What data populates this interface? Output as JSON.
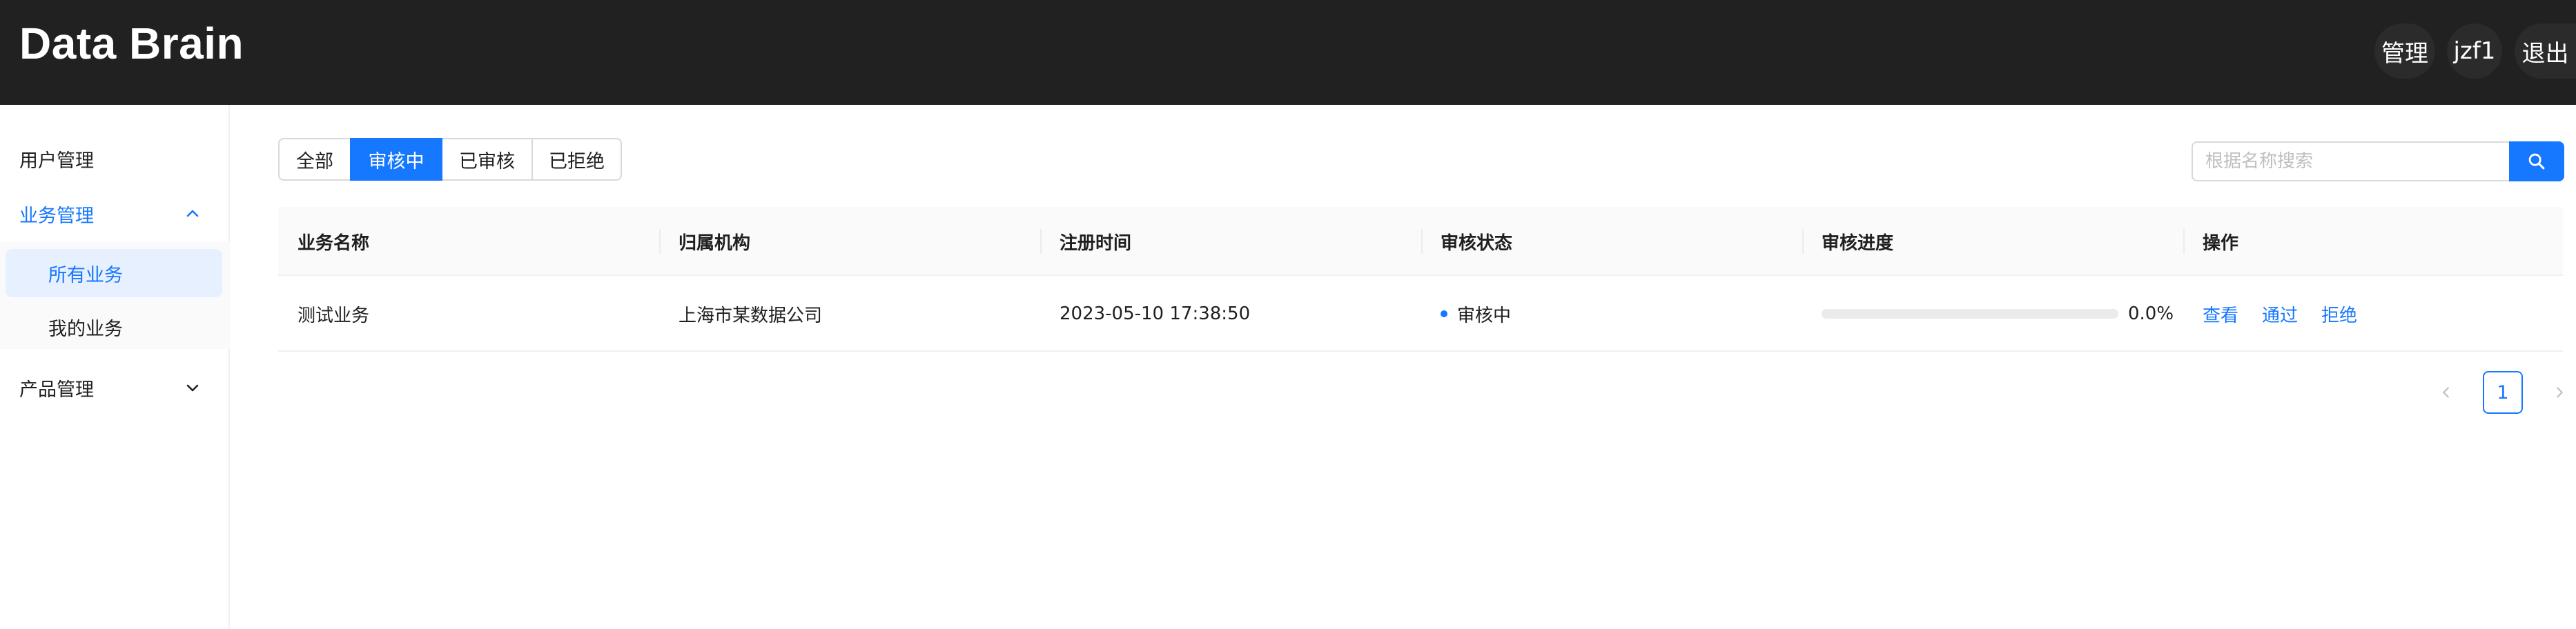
{
  "header": {
    "brand": "Data Brain",
    "nav": [
      "管理",
      "jzf1",
      "退出"
    ]
  },
  "sidebar": {
    "items": [
      {
        "label": "用户管理"
      },
      {
        "label": "业务管理",
        "children": [
          "所有业务",
          "我的业务"
        ]
      },
      {
        "label": "产品管理"
      }
    ]
  },
  "filters": {
    "tabs": [
      "全部",
      "审核中",
      "已审核",
      "已拒绝"
    ],
    "active": "审核中"
  },
  "search": {
    "placeholder": "根据名称搜索"
  },
  "table": {
    "columns": [
      "业务名称",
      "归属机构",
      "注册时间",
      "审核状态",
      "审核进度",
      "操作"
    ],
    "rows": [
      {
        "name": "测试业务",
        "org": "上海市某数据公司",
        "time": "2023-05-10 17:38:50",
        "status": "审核中",
        "progress_text": "0.0%",
        "progress_value": 0,
        "actions": [
          "查看",
          "通过",
          "拒绝"
        ]
      }
    ]
  },
  "pagination": {
    "current": "1"
  },
  "colors": {
    "accent": "#1677ff",
    "header_bg": "#212121"
  }
}
